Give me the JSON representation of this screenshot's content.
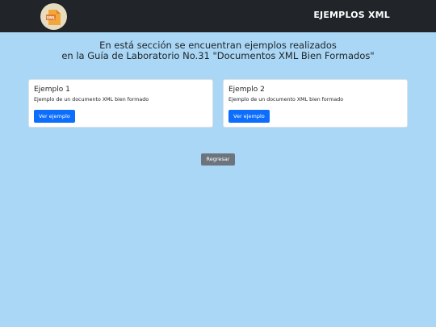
{
  "header": {
    "logo_icon": "xml-file-icon",
    "logo_text": "XML",
    "title": "EJEMPLOS XML"
  },
  "intro": {
    "line1": "En está sección se encuentran ejemplos realizados",
    "line2": "en la Guía de Laboratorio No.31 \"Documentos XML Bien Formados\""
  },
  "cards": [
    {
      "title": "Ejemplo 1",
      "text": "Ejemplo de un documento XML bien formado",
      "button": "Ver ejemplo"
    },
    {
      "title": "Ejemplo 2",
      "text": "Ejemplo de un documento XML bien formado",
      "button": "Ver ejemplo"
    }
  ],
  "back_button": "Regresar",
  "colors": {
    "navbar": "#212529",
    "background": "#a9d7f5",
    "primary": "#0d6efd",
    "secondary": "#6c757d"
  }
}
